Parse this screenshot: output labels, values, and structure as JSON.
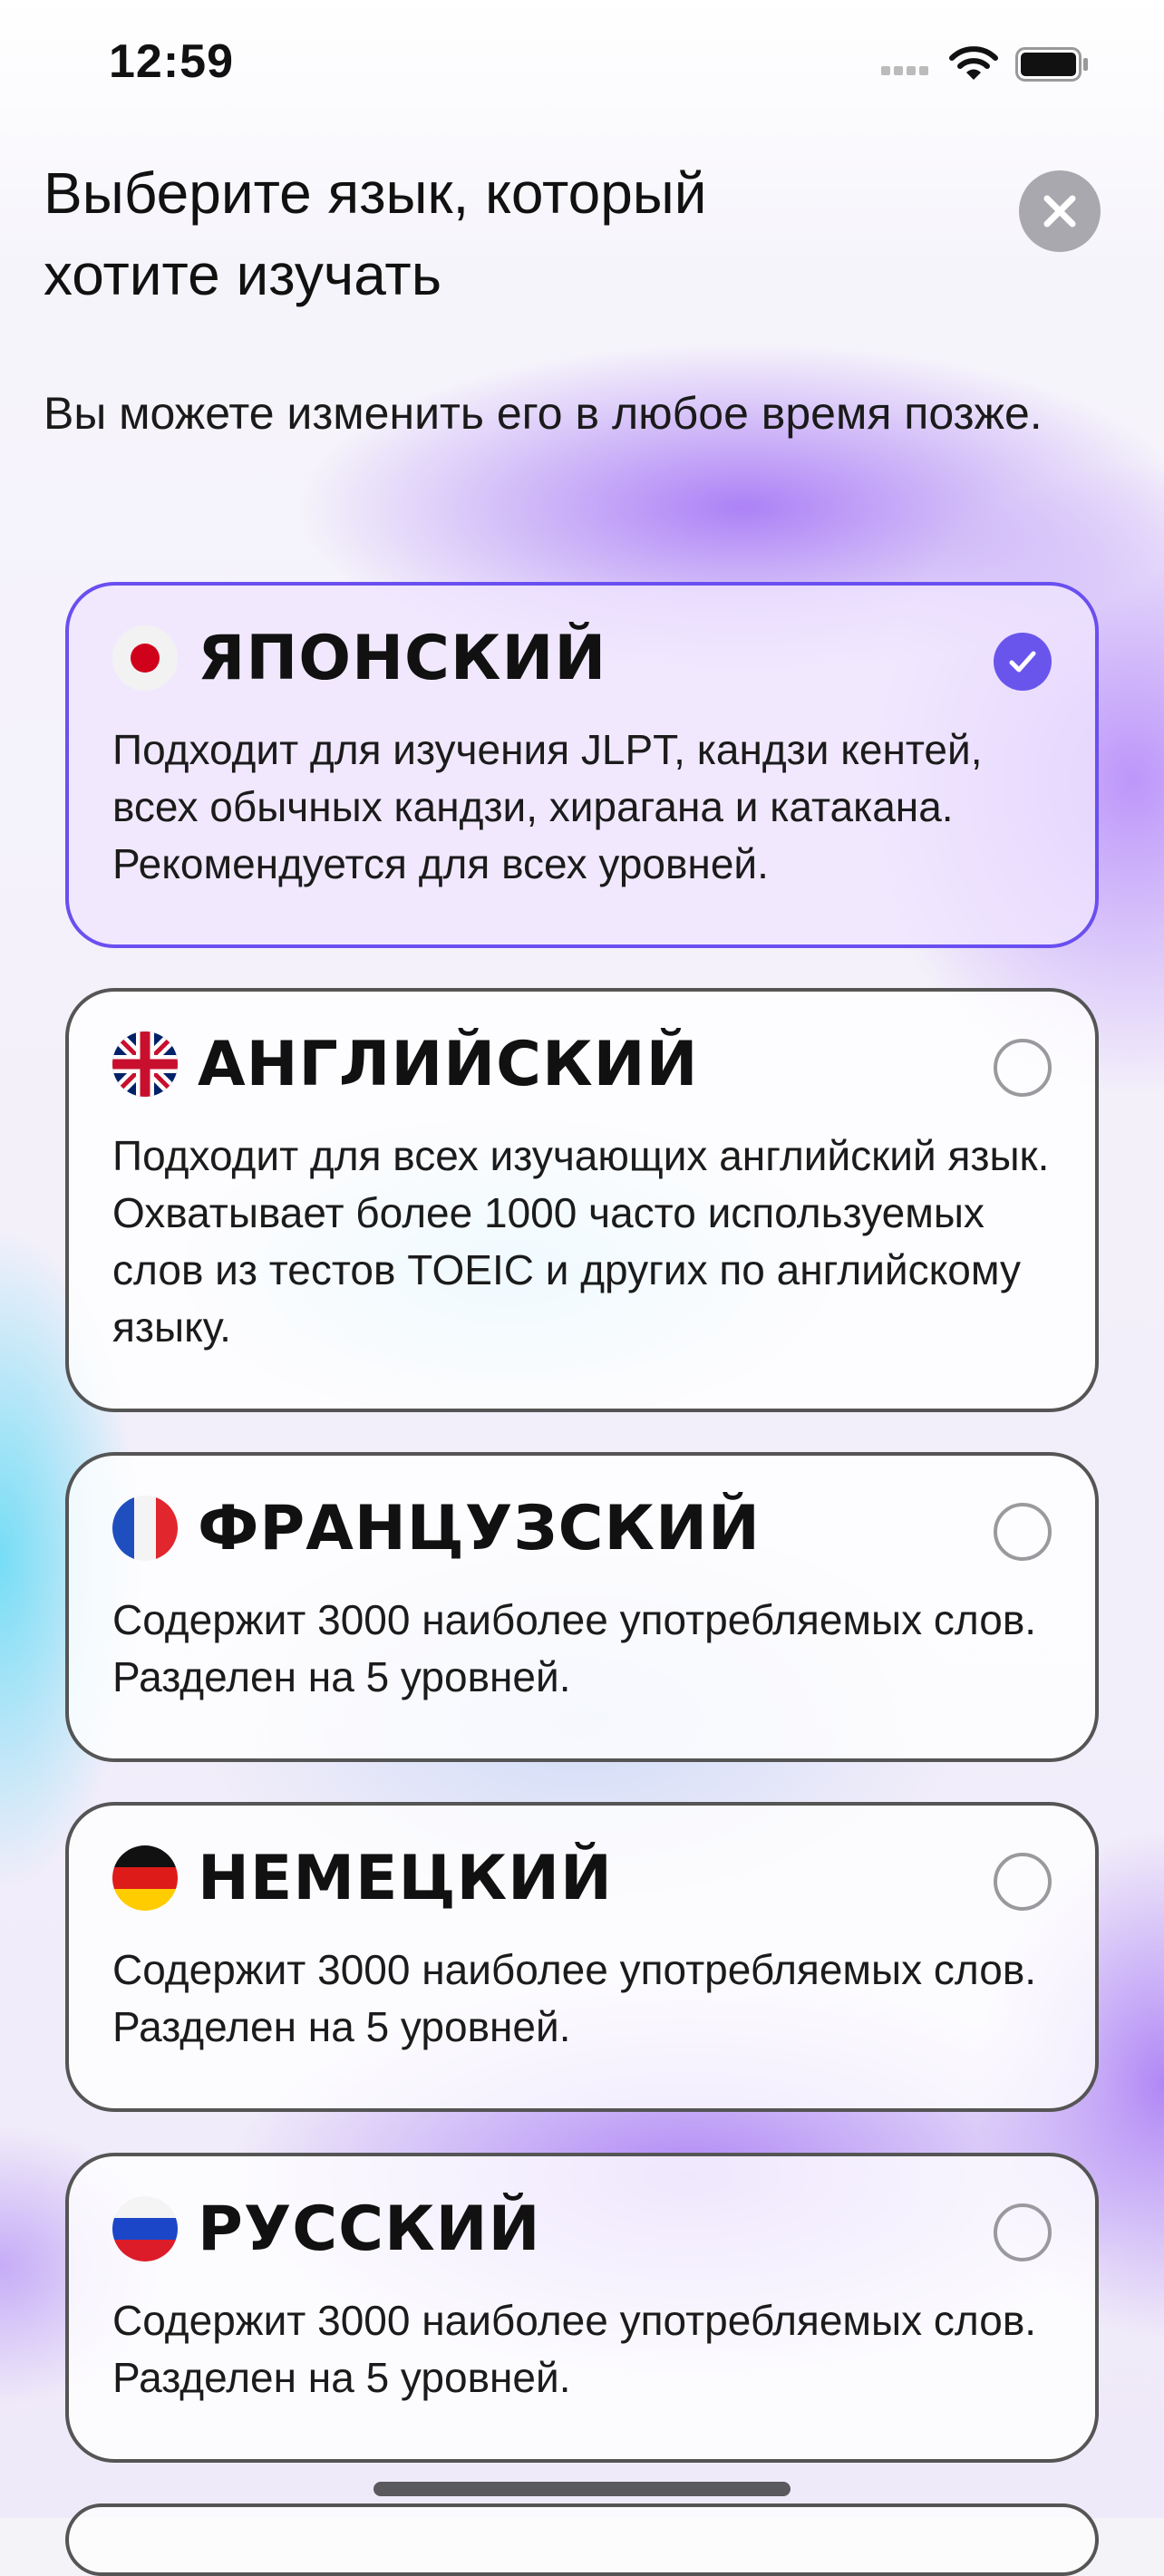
{
  "status_bar": {
    "time": "12:59"
  },
  "header": {
    "title": "Выберите язык, который хотите изучать",
    "subtitle": "Вы можете изменить его в любое время позже."
  },
  "languages": [
    {
      "flag": "japan-flag",
      "name": "ЯПОНСКИЙ",
      "selected": true,
      "description": "Подходит для изучения JLPT, кандзи кентей, всех обычных кандзи, хирагана и катакана. Рекомендуется для всех уровней."
    },
    {
      "flag": "uk-flag",
      "name": "АНГЛИЙСКИЙ",
      "selected": false,
      "description": "Подходит для всех изучающих английский язык. Охватывает более 1000 часто используемых слов из тестов TOEIC и других по английскому языку."
    },
    {
      "flag": "france-flag",
      "name": "ФРАНЦУЗСКИЙ",
      "selected": false,
      "description": "Содержит 3000 наиболее употребляемых слов. Разделен на 5 уровней."
    },
    {
      "flag": "germany-flag",
      "name": "НЕМЕЦКИЙ",
      "selected": false,
      "description": "Содержит 3000 наиболее употребляемых слов. Разделен на 5 уровней."
    },
    {
      "flag": "russia-flag",
      "name": "РУССКИЙ",
      "selected": false,
      "description": "Содержит 3000 наиболее употребляемых слов. Разделен на 5 уровней."
    }
  ],
  "colors": {
    "accent": "#6a55ec",
    "selected_border": "#6a4ff0"
  }
}
